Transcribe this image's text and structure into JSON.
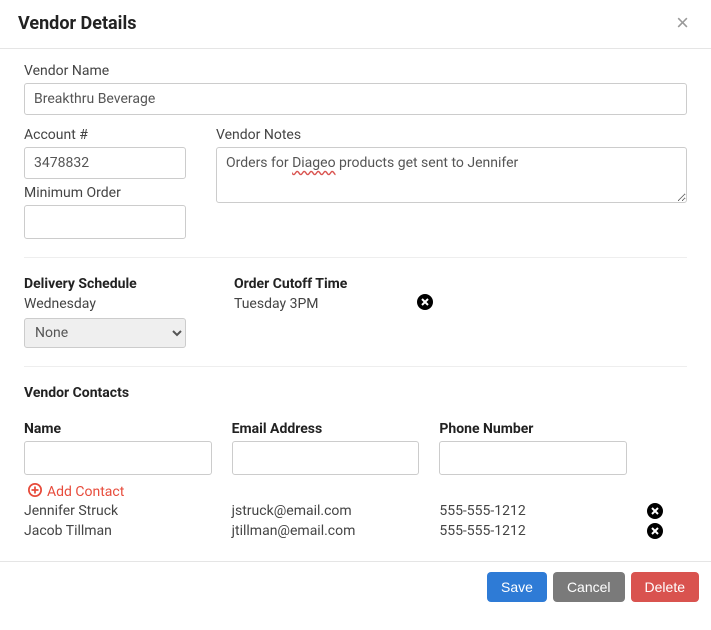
{
  "header": {
    "title": "Vendor Details"
  },
  "fields": {
    "vendor_name_label": "Vendor Name",
    "vendor_name_value": "Breakthru Beverage",
    "account_label": "Account #",
    "account_value": "3478832",
    "min_order_label": "Minimum Order",
    "min_order_value": "",
    "vendor_notes_label": "Vendor Notes",
    "vendor_notes_prefix": "Orders for ",
    "vendor_notes_misspelled": "Diageo",
    "vendor_notes_suffix": "  products get sent to Jennifer"
  },
  "delivery": {
    "schedule_label": "Delivery Schedule",
    "schedule_day": "Wednesday",
    "select_value": "None",
    "cutoff_label": "Order Cutoff Time",
    "cutoff_value": "Tuesday 3PM"
  },
  "contacts": {
    "heading": "Vendor Contacts",
    "col_name": "Name",
    "col_email": "Email Address",
    "col_phone": "Phone Number",
    "add_label": "Add Contact",
    "rows": [
      {
        "name": "Jennifer Struck",
        "email": "jstruck@email.com",
        "phone": "555-555-1212"
      },
      {
        "name": "Jacob Tillman",
        "email": "jtillman@email.com",
        "phone": "555-555-1212"
      }
    ]
  },
  "footer": {
    "save": "Save",
    "cancel": "Cancel",
    "delete": "Delete"
  }
}
